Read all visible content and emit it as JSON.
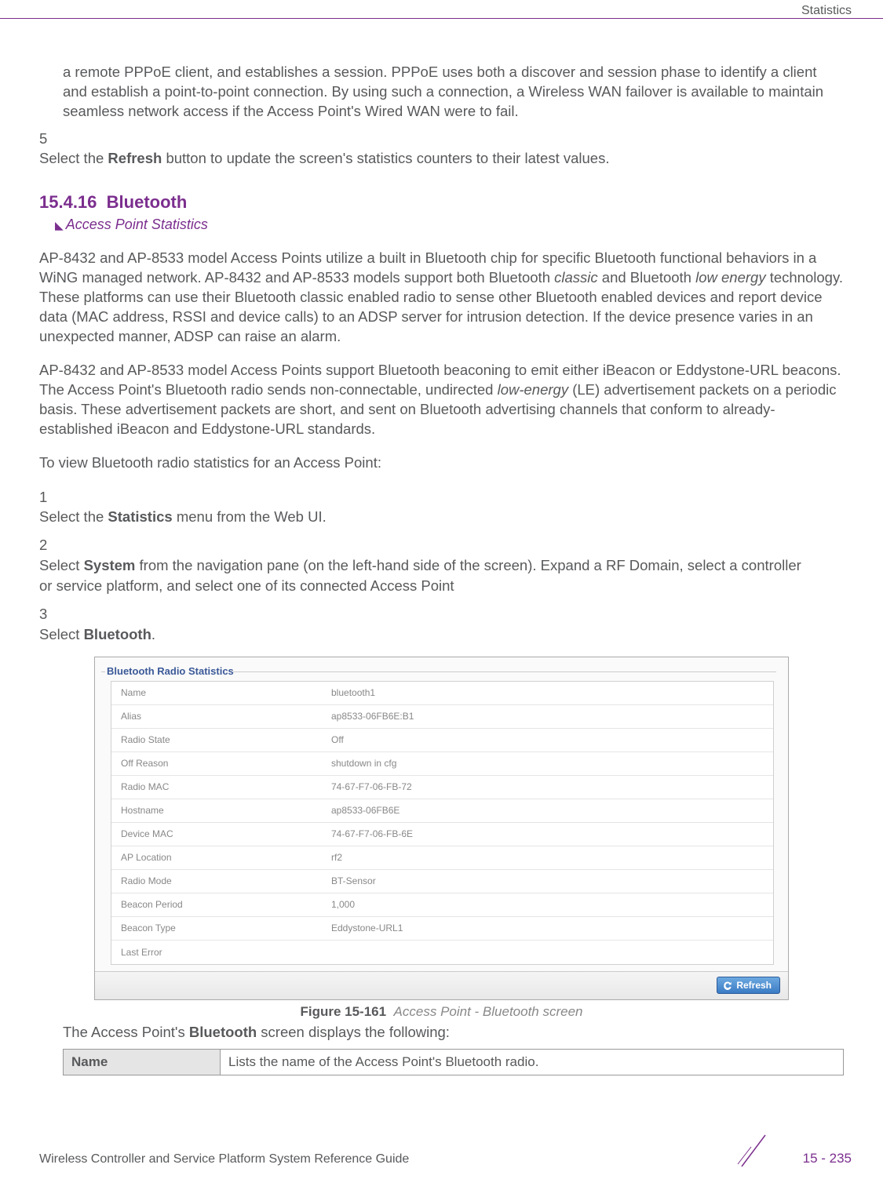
{
  "header": {
    "section": "Statistics"
  },
  "para1": "a remote PPPoE client, and establishes a session. PPPoE uses both a discover and session phase to identify a client and establish a point-to-point connection. By using such a connection, a Wireless WAN failover is available to maintain seamless network access if the Access Point's Wired WAN were to fail.",
  "step5": {
    "num": "5",
    "before": "Select the ",
    "bold": "Refresh",
    "after": " button to update the screen's statistics counters to their latest values."
  },
  "section": {
    "number": "15.4.16",
    "title": "Bluetooth",
    "link": "Access Point Statistics"
  },
  "body1": {
    "p1a": "AP-8432 and AP-8533 model Access Points utilize a built in Bluetooth chip for specific Bluetooth functional behaviors in a WiNG managed network. AP-8432 and AP-8533 models support both Bluetooth ",
    "p1i1": "classic",
    "p1b": " and Bluetooth ",
    "p1i2": "low energy",
    "p1c": " technology. These platforms can use their Bluetooth classic enabled radio to sense other Bluetooth enabled devices and report device data (MAC address, RSSI and device calls) to an ADSP server for intrusion detection. If the device presence varies in an unexpected manner, ADSP can raise an alarm."
  },
  "body2": {
    "a": "AP-8432 and AP-8533 model Access Points support Bluetooth beaconing to emit either iBeacon or Eddystone-URL beacons. The Access Point's Bluetooth radio sends non-connectable, undirected ",
    "i": "low-energy",
    "b": " (LE) advertisement packets on a periodic basis. These advertisement packets are short, and sent on Bluetooth advertising channels that conform to already-established iBeacon and Eddystone-URL standards."
  },
  "intro": "To view Bluetooth radio statistics for an Access Point:",
  "steps": [
    {
      "num": "1",
      "before": "Select the ",
      "bold": "Statistics",
      "after": " menu from the Web UI."
    },
    {
      "num": "2",
      "before": "Select ",
      "bold": "System",
      "after": " from the navigation pane (on the left-hand side of the screen). Expand a RF Domain, select a controller or service platform, and select one of its connected Access Point"
    },
    {
      "num": "3",
      "before": "Select ",
      "bold": "Bluetooth",
      "after": "."
    }
  ],
  "panel": {
    "title": "Bluetooth Radio Statistics",
    "rows": [
      {
        "label": "Name",
        "value": "bluetooth1"
      },
      {
        "label": "Alias",
        "value": "ap8533-06FB6E:B1"
      },
      {
        "label": "Radio State",
        "value": "Off"
      },
      {
        "label": "Off Reason",
        "value": "shutdown in cfg"
      },
      {
        "label": "Radio MAC",
        "value": "74-67-F7-06-FB-72"
      },
      {
        "label": "Hostname",
        "value": "ap8533-06FB6E"
      },
      {
        "label": "Device MAC",
        "value": "74-67-F7-06-FB-6E"
      },
      {
        "label": "AP Location",
        "value": "rf2"
      },
      {
        "label": "Radio Mode",
        "value": "BT-Sensor"
      },
      {
        "label": "Beacon Period",
        "value": "1,000"
      },
      {
        "label": "Beacon Type",
        "value": "Eddystone-URL1"
      },
      {
        "label": "Last Error",
        "value": ""
      }
    ],
    "refresh": "Refresh"
  },
  "figure": {
    "label": "Figure 15-161",
    "desc": "Access Point - Bluetooth screen"
  },
  "afterFig": {
    "before": "The Access Point's ",
    "bold": "Bluetooth",
    "after": " screen displays the following:"
  },
  "descTable": {
    "name": "Name",
    "desc": "Lists the name of the Access Point's Bluetooth radio."
  },
  "footer": {
    "guide": "Wireless Controller and Service Platform System Reference Guide",
    "page": "15 - 235"
  }
}
